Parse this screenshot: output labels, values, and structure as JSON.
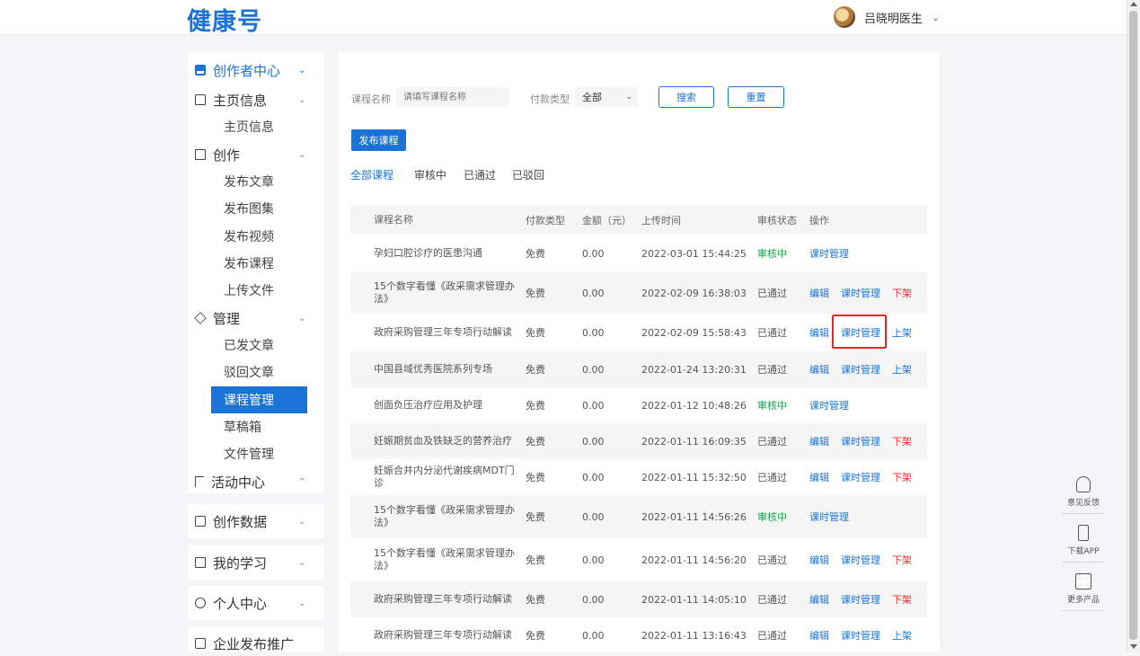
{
  "header": {
    "logo": "健康号",
    "user_name": "吕晓明医生",
    "user_chevron": "⌄"
  },
  "sidebar": {
    "groups": [
      {
        "label": "创作者中心",
        "icon": "creator-icon",
        "arrow": "⌄"
      },
      {
        "label": "主页信息",
        "icon": "home-icon",
        "arrow": "⌄"
      },
      {
        "label": "创作",
        "icon": "edit-icon",
        "arrow": "⌄"
      },
      {
        "label": "管理",
        "icon": "layers-icon",
        "arrow": "⌄"
      },
      {
        "label": "活动中心",
        "icon": "flag-icon",
        "arrow": "^"
      },
      {
        "label": "创作数据",
        "icon": "chart-icon",
        "arrow": "⌄"
      },
      {
        "label": "我的学习",
        "icon": "book-icon",
        "arrow": "⌄"
      },
      {
        "label": "个人中心",
        "icon": "user-icon",
        "arrow": "⌄"
      },
      {
        "label": "企业发布推广",
        "icon": "building-icon"
      }
    ],
    "sub_home": [
      "主页信息"
    ],
    "sub_create": [
      "发布文章",
      "发布图集",
      "发布视频",
      "发布课程",
      "上传文件"
    ],
    "sub_manage": [
      "已发文章",
      "驳回文章",
      "课程管理",
      "草稿箱",
      "文件管理"
    ]
  },
  "filters": {
    "course_name_label": "课程名称",
    "course_name_placeholder": "请填写课程名称",
    "pay_type_label": "付款类型",
    "pay_type_value": "全部",
    "search_label": "搜索",
    "reset_label": "重置",
    "publish_label": "发布课程"
  },
  "tabs": [
    "全部课程",
    "审核中",
    "已通过",
    "已驳回"
  ],
  "table": {
    "headers": [
      "课程名称",
      "付款类型",
      "金额（元）",
      "上传时间",
      "审核状态",
      "操作"
    ],
    "rows": [
      {
        "name": "孕妇口腔诊疗的医患沟通",
        "pay": "免费",
        "amount": "0.00",
        "time": "2022-03-01 15:44:25",
        "status": "审核中",
        "actions": [
          "课时管理"
        ]
      },
      {
        "name": "15个数字看懂《政采需求管理办法》",
        "pay": "免费",
        "amount": "0.00",
        "time": "2022-02-09 16:38:03",
        "status": "已通过",
        "actions": [
          "编辑",
          "课时管理",
          "下架"
        ]
      },
      {
        "name": "政府采购管理三年专项行动解读",
        "pay": "免费",
        "amount": "0.00",
        "time": "2022-02-09 15:58:43",
        "status": "已通过",
        "actions": [
          "编辑",
          "课时管理",
          "上架"
        ]
      },
      {
        "name": "中国县域优秀医院系列专场",
        "pay": "免费",
        "amount": "0.00",
        "time": "2022-01-24 13:20:31",
        "status": "已通过",
        "actions": [
          "编辑",
          "课时管理",
          "上架"
        ]
      },
      {
        "name": "创面负压治疗应用及护理",
        "pay": "免费",
        "amount": "0.00",
        "time": "2022-01-12 10:48:26",
        "status": "审核中",
        "actions": [
          "课时管理"
        ]
      },
      {
        "name": "妊娠期贫血及铁缺乏的营养治疗",
        "pay": "免费",
        "amount": "0.00",
        "time": "2022-01-11 16:09:35",
        "status": "已通过",
        "actions": [
          "编辑",
          "课时管理",
          "下架"
        ]
      },
      {
        "name": "妊娠合并内分泌代谢疾病MDT门诊",
        "pay": "免费",
        "amount": "0.00",
        "time": "2022-01-11 15:32:50",
        "status": "已通过",
        "actions": [
          "编辑",
          "课时管理",
          "下架"
        ]
      },
      {
        "name": "15个数字看懂《政采需求管理办法》",
        "pay": "免费",
        "amount": "0.00",
        "time": "2022-01-11 14:56:26",
        "status": "审核中",
        "actions": [
          "课时管理"
        ]
      },
      {
        "name": "15个数字看懂《政采需求管理办法》",
        "pay": "免费",
        "amount": "0.00",
        "time": "2022-01-11 14:56:20",
        "status": "已通过",
        "actions": [
          "编辑",
          "课时管理",
          "下架"
        ]
      },
      {
        "name": "政府采购管理三年专项行动解读",
        "pay": "免费",
        "amount": "0.00",
        "time": "2022-01-11 14:05:10",
        "status": "已通过",
        "actions": [
          "编辑",
          "课时管理",
          "下架"
        ]
      },
      {
        "name": "政府采购管理三年专项行动解读",
        "pay": "免费",
        "amount": "0.00",
        "time": "2022-01-11 13:16:43",
        "status": "已通过",
        "actions": [
          "编辑",
          "课时管理",
          "上架"
        ]
      }
    ]
  },
  "float_bar": [
    {
      "label": "意见反馈",
      "icon": "headset-icon"
    },
    {
      "label": "下载APP",
      "icon": "phone-icon"
    },
    {
      "label": "更多产品",
      "icon": "grid-icon"
    }
  ],
  "colors": {
    "primary": "#1a74d8",
    "status_pending": "#1aa34a",
    "danger": "#e5322e",
    "highlight": "#e02a2a"
  }
}
